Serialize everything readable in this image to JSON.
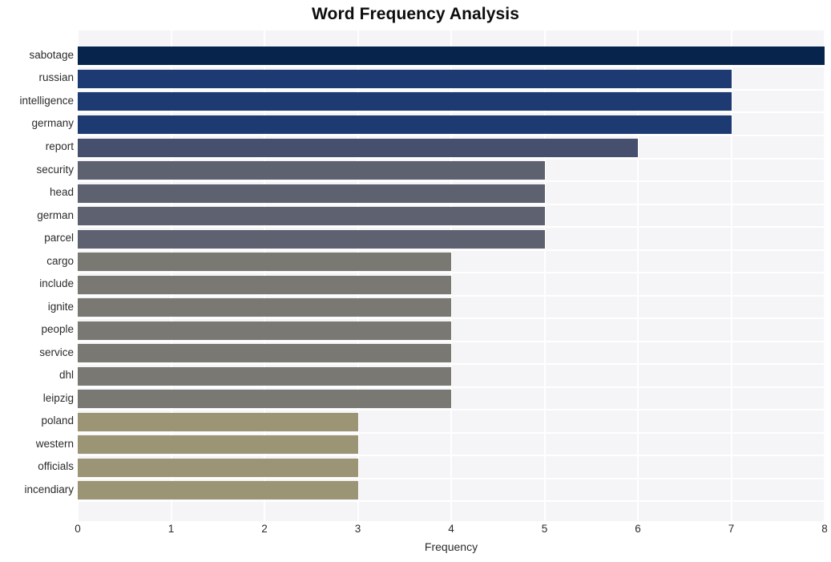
{
  "chart_data": {
    "type": "bar",
    "orientation": "horizontal",
    "title": "Word Frequency Analysis",
    "xlabel": "Frequency",
    "ylabel": "",
    "categories": [
      "sabotage",
      "russian",
      "intelligence",
      "germany",
      "report",
      "security",
      "head",
      "german",
      "parcel",
      "cargo",
      "include",
      "ignite",
      "people",
      "service",
      "dhl",
      "leipzig",
      "poland",
      "western",
      "officials",
      "incendiary"
    ],
    "values": [
      8,
      7,
      7,
      7,
      6,
      5,
      5,
      5,
      5,
      4,
      4,
      4,
      4,
      4,
      4,
      4,
      3,
      3,
      3,
      3
    ],
    "bar_colors": [
      "#07244d",
      "#1d3b72",
      "#1d3b72",
      "#1d3b72",
      "#464f6e",
      "#5e6170",
      "#5e6170",
      "#5e6170",
      "#5e6170",
      "#797873",
      "#797873",
      "#797873",
      "#797873",
      "#797873",
      "#797873",
      "#797873",
      "#9b9475",
      "#9b9475",
      "#9b9475",
      "#9b9475"
    ],
    "xlim": [
      0,
      8
    ],
    "xticks": [
      0,
      1,
      2,
      3,
      4,
      5,
      6,
      7,
      8
    ],
    "xticklabels": [
      "0",
      "1",
      "2",
      "3",
      "4",
      "5",
      "6",
      "7",
      "8"
    ],
    "grid": true,
    "grid_color": "#ffffff",
    "plot_background": "#f5f5f7",
    "figure_background": "#ffffff",
    "legend": null
  }
}
